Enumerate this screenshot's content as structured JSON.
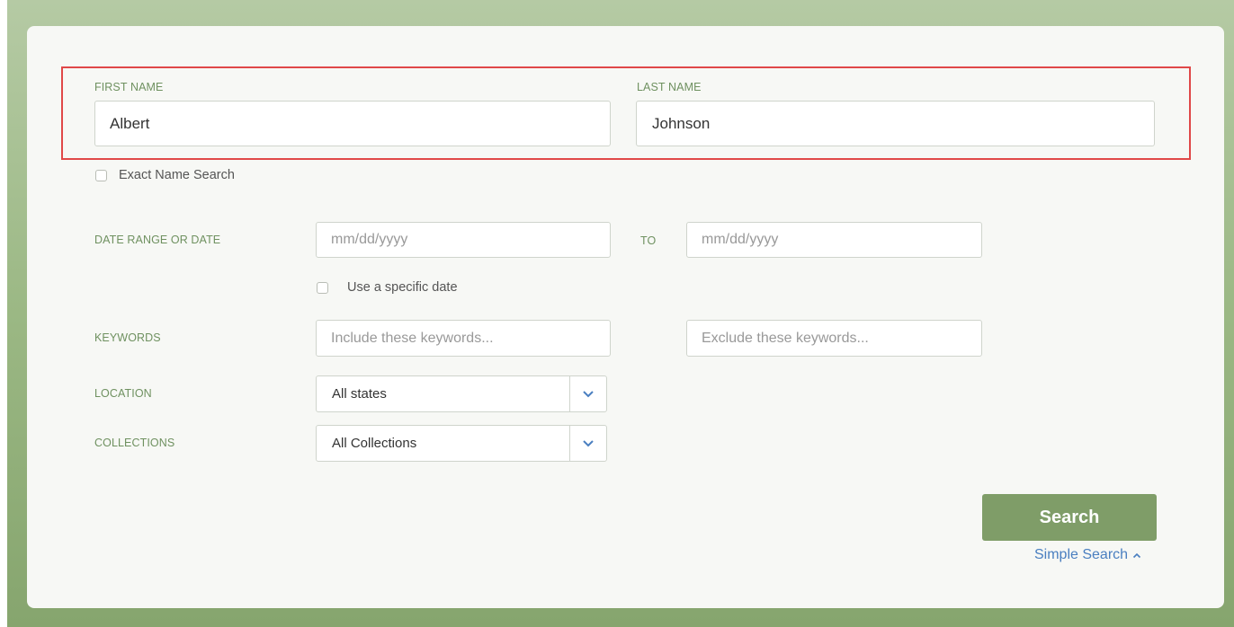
{
  "form": {
    "first_name": {
      "label": "FIRST NAME",
      "value": "Albert"
    },
    "last_name": {
      "label": "LAST NAME",
      "value": "Johnson"
    },
    "exact_name": {
      "label": "Exact Name Search",
      "checked": false
    },
    "date": {
      "label": "DATE RANGE OR DATE",
      "from_placeholder": "mm/dd/yyyy",
      "to_label": "TO",
      "to_placeholder": "mm/dd/yyyy",
      "specific_label": "Use a specific date",
      "specific_checked": false
    },
    "keywords": {
      "label": "KEYWORDS",
      "include_placeholder": "Include these keywords...",
      "exclude_placeholder": "Exclude these keywords..."
    },
    "location": {
      "label": "LOCATION",
      "selected": "All states"
    },
    "collections": {
      "label": "COLLECTIONS",
      "selected": "All Collections"
    },
    "search_button": "Search",
    "simple_search_link": "Simple Search"
  },
  "colors": {
    "label_green": "#6f9160",
    "button_green": "#7f9d68",
    "link_blue": "#4a7fc0",
    "highlight_red": "#e04848"
  },
  "icons": {
    "dropdown": "chevron-down-icon",
    "simple_search": "chevron-up-icon"
  }
}
